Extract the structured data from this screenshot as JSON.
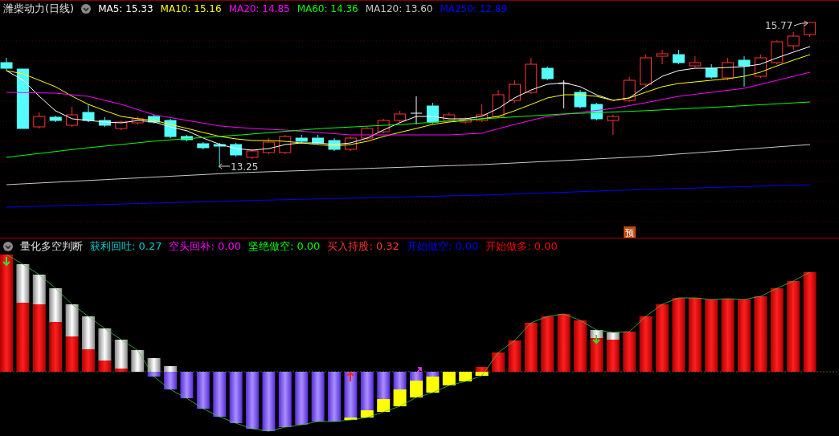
{
  "main_chart": {
    "title": "潍柴动力(日线)",
    "indicators": [
      {
        "label": "MA5: 15.33",
        "color": "#ffffff"
      },
      {
        "label": "MA10: 15.16",
        "color": "#ffff00"
      },
      {
        "label": "MA20: 14.85",
        "color": "#ff00ff"
      },
      {
        "label": "MA60: 14.36",
        "color": "#00ff00"
      },
      {
        "label": "MA120: 13.60",
        "color": "#c8c8c8"
      },
      {
        "label": "MA250: 12.89",
        "color": "#0000ff"
      }
    ],
    "high_marker": "15.77",
    "low_marker": "13.25",
    "event_badge": "预"
  },
  "sub_chart": {
    "title": "量化多空判断",
    "indicators": [
      {
        "label": "获利回吐: 0.27",
        "color": "#00c8c8"
      },
      {
        "label": "空头回补: 0.00",
        "color": "#ff00ff"
      },
      {
        "label": "坚绝做空: 0.00",
        "color": "#00ff00"
      },
      {
        "label": "买入持股: 0.32",
        "color": "#ff3232"
      },
      {
        "label": "开始做空: 0.00",
        "color": "#0000ff"
      },
      {
        "label": "开始做多: 0.00",
        "color": "#ff0000"
      }
    ]
  }
}
